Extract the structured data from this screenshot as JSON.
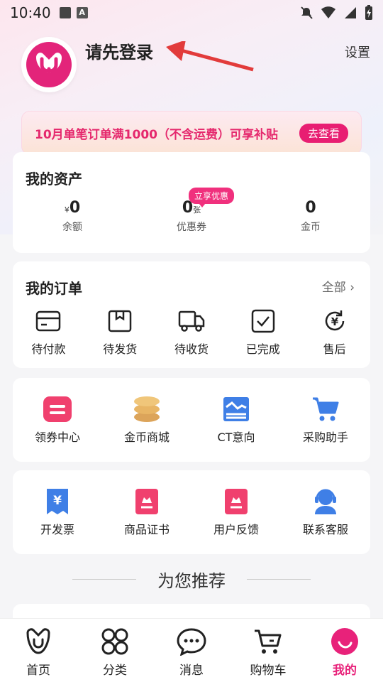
{
  "status_bar": {
    "time": "10:40"
  },
  "profile": {
    "login_prompt": "请先登录",
    "settings_label": "设置"
  },
  "promo": {
    "text": "10月单笔订单满1000（不含运费）可享补贴",
    "button_label": "去查看"
  },
  "assets": {
    "title": "我的资产",
    "badge": "立享优惠",
    "items": [
      {
        "prefix": "¥",
        "value": "0",
        "suffix": "",
        "label": "余额"
      },
      {
        "prefix": "",
        "value": "0",
        "suffix": "张",
        "label": "优惠券"
      },
      {
        "prefix": "",
        "value": "0",
        "suffix": "",
        "label": "金币"
      }
    ]
  },
  "orders": {
    "title": "我的订单",
    "all_label": "全部",
    "items": [
      {
        "label": "待付款",
        "icon": "wallet-icon"
      },
      {
        "label": "待发货",
        "icon": "package-icon"
      },
      {
        "label": "待收货",
        "icon": "truck-icon"
      },
      {
        "label": "已完成",
        "icon": "check-square-icon"
      },
      {
        "label": "售后",
        "icon": "yen-refresh-icon"
      }
    ]
  },
  "tools_row1": [
    {
      "label": "领券中心",
      "icon": "coupon-icon",
      "color": "#f0406e"
    },
    {
      "label": "金币商城",
      "icon": "coins-icon",
      "color": "#e8b565"
    },
    {
      "label": "CT意向",
      "icon": "ct-intent-icon",
      "color": "#3f7fe6"
    },
    {
      "label": "采购助手",
      "icon": "cart-icon",
      "color": "#3f7fe6"
    }
  ],
  "tools_row2": [
    {
      "label": "开发票",
      "icon": "invoice-icon",
      "color": "#3f7fe6"
    },
    {
      "label": "商品证书",
      "icon": "certificate-icon",
      "color": "#f0406e"
    },
    {
      "label": "用户反馈",
      "icon": "feedback-icon",
      "color": "#f0406e"
    },
    {
      "label": "联系客服",
      "icon": "customer-service-icon",
      "color": "#3f7fe6"
    }
  ],
  "recommend_title": "为您推荐",
  "bottom_nav": [
    {
      "label": "首页",
      "icon": "home-icon",
      "active": false
    },
    {
      "label": "分类",
      "icon": "category-icon",
      "active": false
    },
    {
      "label": "消息",
      "icon": "message-icon",
      "active": false
    },
    {
      "label": "购物车",
      "icon": "cart-nav-icon",
      "active": false
    },
    {
      "label": "我的",
      "icon": "profile-nav-icon",
      "active": true
    }
  ],
  "colors": {
    "brand_pink": "#e8227a",
    "promo_text": "#e5286d",
    "blue_icon": "#3f7fe6"
  }
}
